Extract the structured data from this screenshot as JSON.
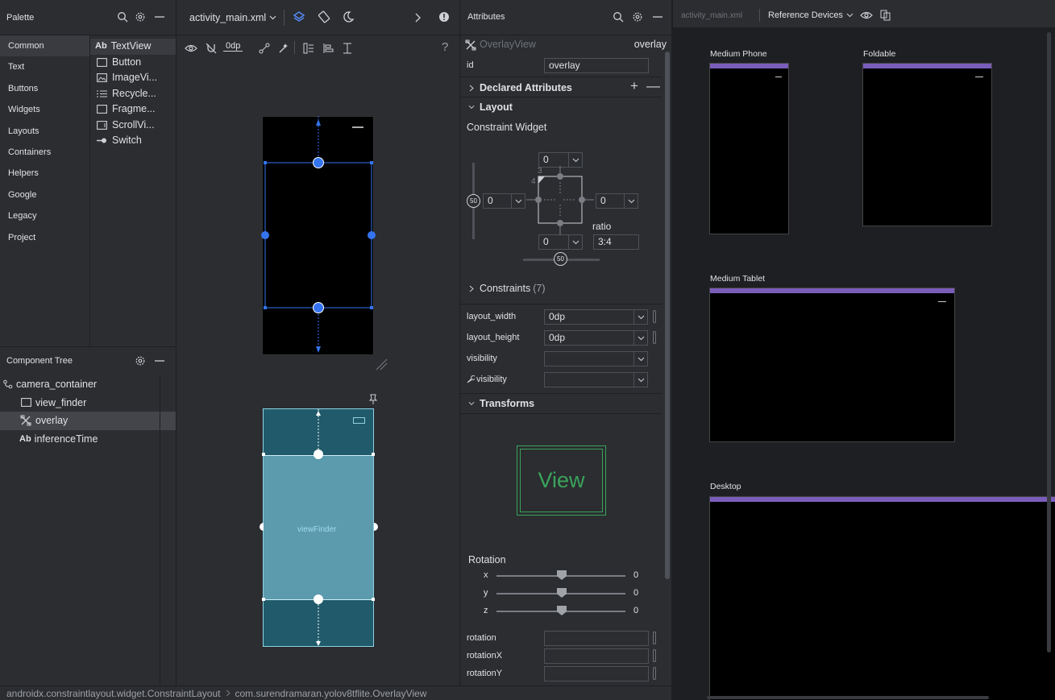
{
  "palette": {
    "title": "Palette",
    "categories": [
      "Common",
      "Text",
      "Buttons",
      "Widgets",
      "Layouts",
      "Containers",
      "Helpers",
      "Google",
      "Legacy",
      "Project"
    ],
    "selected_category": "Common",
    "items": [
      {
        "prefix": "Ab",
        "label": "TextView"
      },
      {
        "prefix": "",
        "label": "Button"
      },
      {
        "prefix": "",
        "label": "ImageVi..."
      },
      {
        "prefix": "",
        "label": "Recycle..."
      },
      {
        "prefix": "",
        "label": "Fragme..."
      },
      {
        "prefix": "",
        "label": "ScrollVi..."
      },
      {
        "prefix": "",
        "label": "Switch"
      }
    ]
  },
  "component_tree": {
    "title": "Component Tree",
    "items": [
      {
        "label": "camera_container",
        "indent": 0
      },
      {
        "label": "view_finder",
        "indent": 1
      },
      {
        "label": "overlay",
        "indent": 1,
        "selected": true
      },
      {
        "prefix": "Ab",
        "label": "inferenceTime",
        "indent": 1
      }
    ]
  },
  "editor": {
    "file_tab": "activity_main.xml",
    "margin_value": "0dp",
    "help": "?",
    "blueprint_label": "viewFinder"
  },
  "attributes": {
    "title": "Attributes",
    "component_type": "OverlayView",
    "component_id_short": "overlay",
    "id_label": "id",
    "id_value": "overlay",
    "declared_label": "Declared Attributes",
    "layout_label": "Layout",
    "constraint_widget_label": "Constraint Widget",
    "cw_top": "0",
    "cw_left": "0",
    "cw_right": "0",
    "cw_bottom": "0",
    "cw_bias_v": "50",
    "cw_bias_h": "50",
    "cw_marker_3": "3",
    "cw_marker_4": "4",
    "ratio_label": "ratio",
    "ratio_value": "3:4",
    "constraints_label": "Constraints",
    "constraints_count": "(7)",
    "rows": [
      {
        "label": "layout_width",
        "value": "0dp"
      },
      {
        "label": "layout_height",
        "value": "0dp"
      },
      {
        "label": "visibility",
        "value": ""
      },
      {
        "label": "visibility",
        "value": "",
        "tool": true
      }
    ],
    "transforms_label": "Transforms",
    "view_preview": "View",
    "rotation_label": "Rotation",
    "rotation_axes": [
      {
        "axis": "x",
        "value": "0"
      },
      {
        "axis": "y",
        "value": "0"
      },
      {
        "axis": "z",
        "value": "0"
      }
    ],
    "rotation_rows": [
      "rotation",
      "rotationX",
      "rotationY"
    ]
  },
  "reference": {
    "file": "activity_main.xml",
    "devices_label": "Reference Devices",
    "devices": [
      "Medium Phone",
      "Foldable",
      "Medium Tablet",
      "Desktop"
    ]
  },
  "breadcrumb": {
    "items": [
      "androidx.constraintlayout.widget.ConstraintLayout",
      "com.surendramaran.yolov8tflite.OverlayView"
    ]
  },
  "colors": {
    "accent_blue": "#3574f0",
    "device_bar": "#7a5dba",
    "blueprint": "#205a6b",
    "view_green": "#3aa35b"
  }
}
